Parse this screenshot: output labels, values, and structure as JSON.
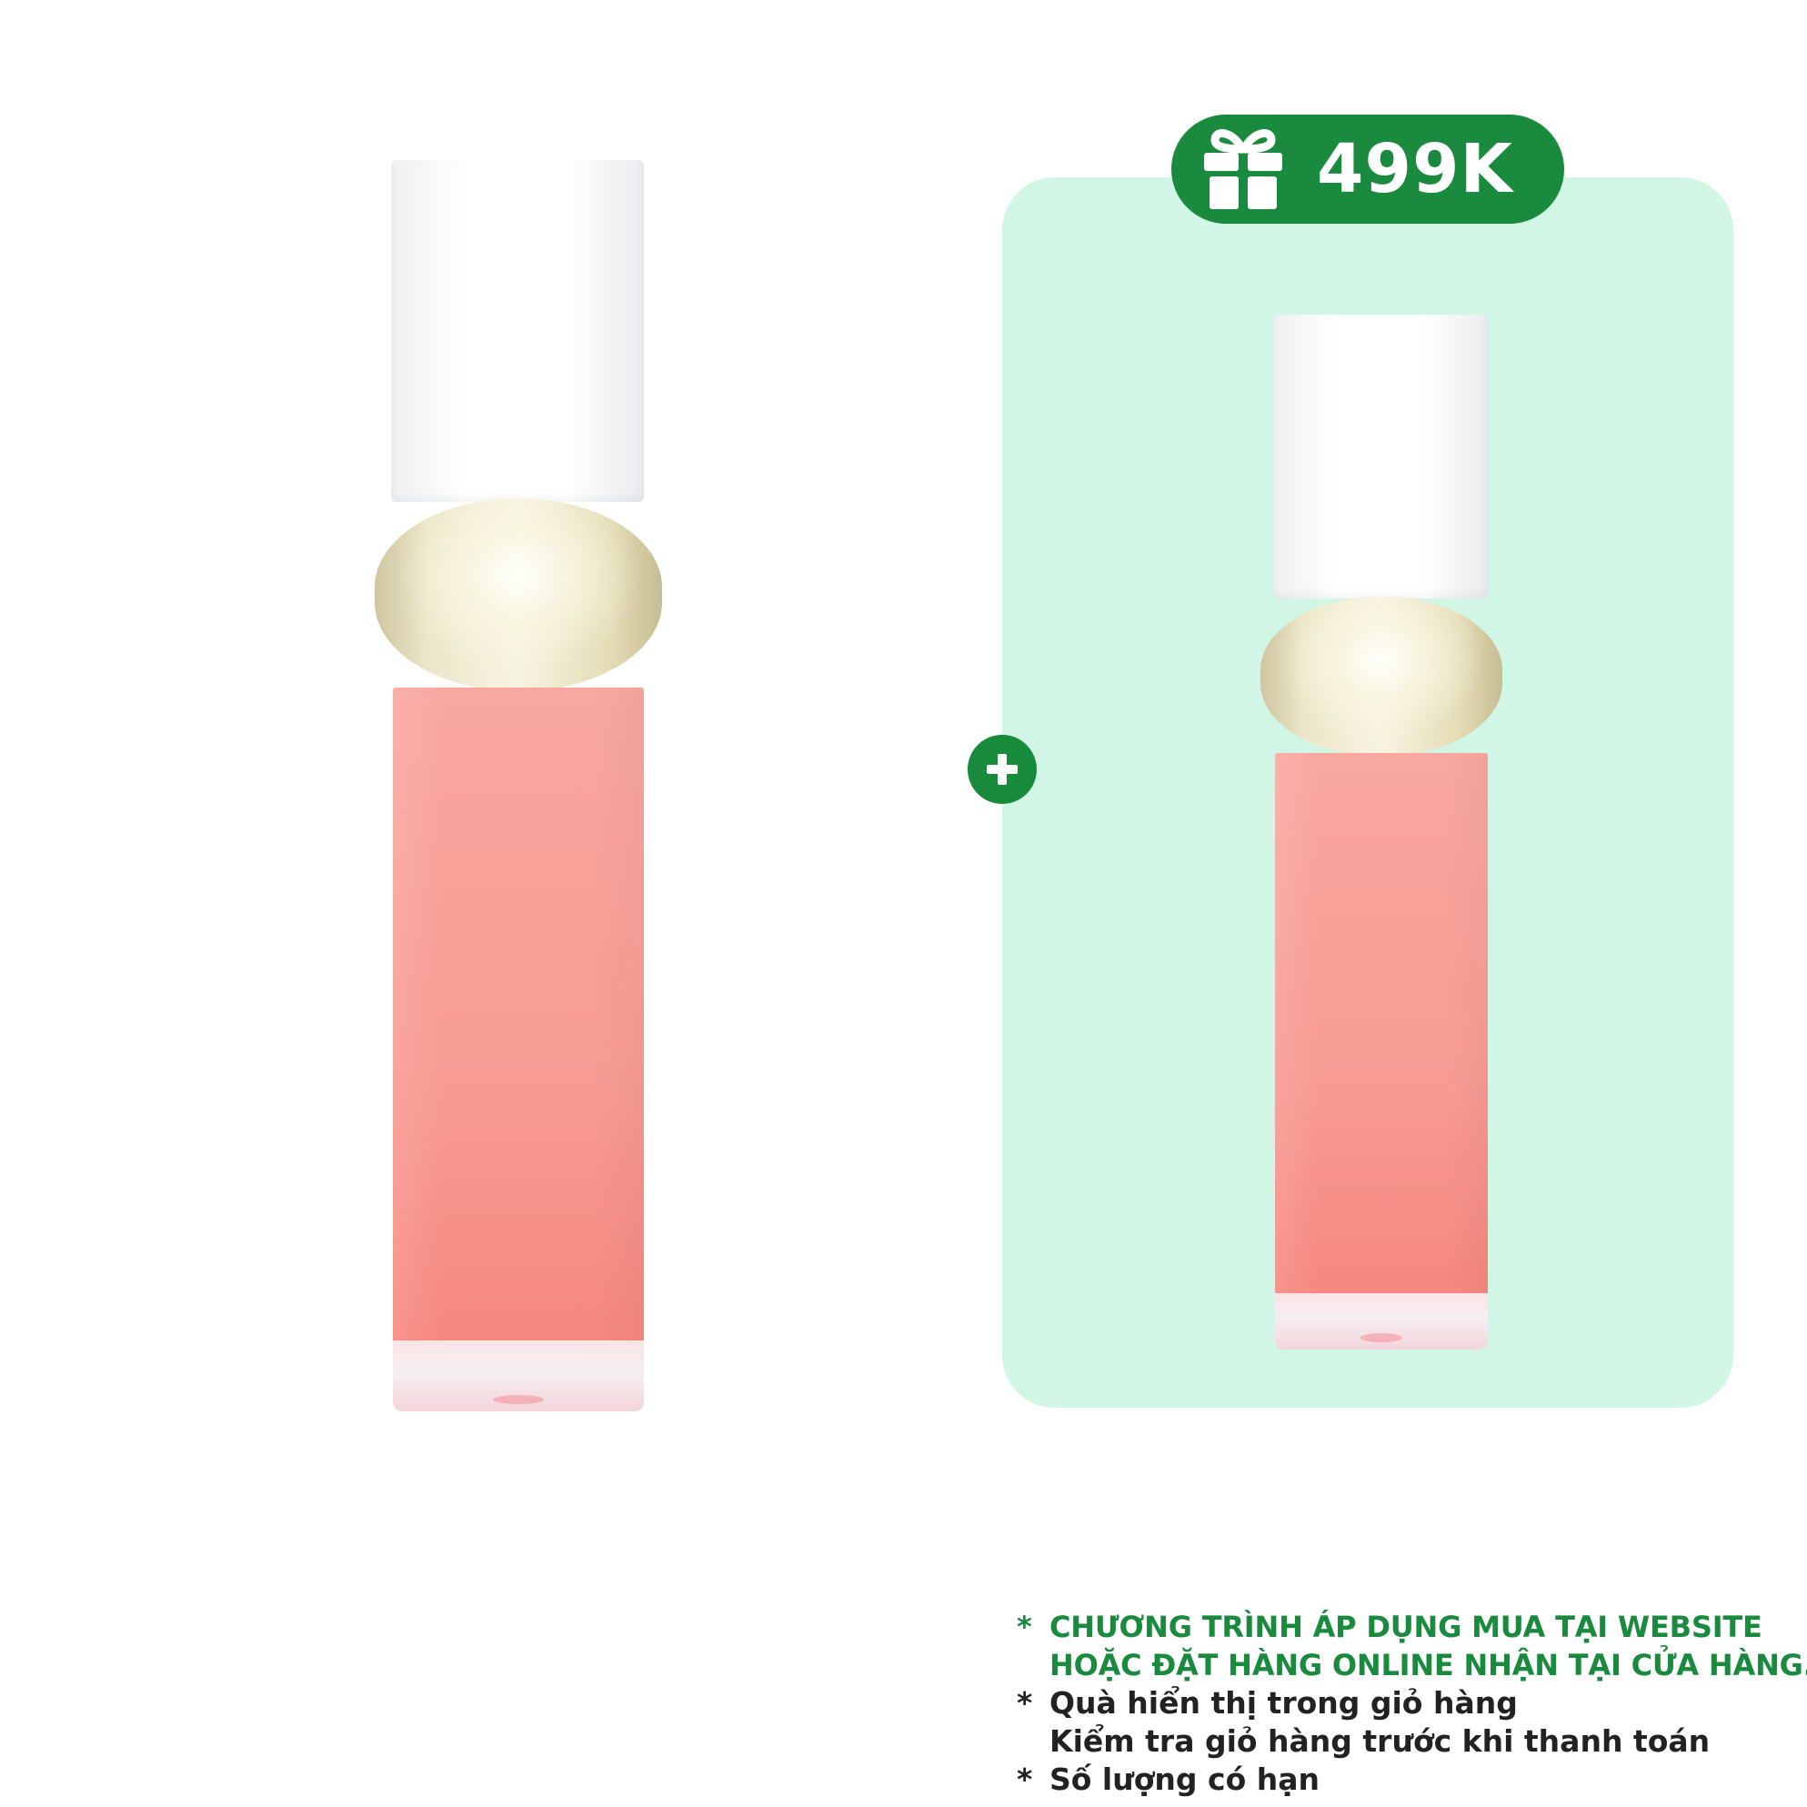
{
  "badge": {
    "icon": "gift-icon",
    "price": "499K",
    "color": "#1a8a3e"
  },
  "panel": {
    "background": "#d1f6e5"
  },
  "plus_button": {
    "icon": "plus-icon"
  },
  "notes": {
    "bullet": "*",
    "program": {
      "line1": "CHƯƠNG TRÌNH ÁP DỤNG MUA TẠI WEBSITE",
      "line2": "HOẶC ĐẶT HÀNG ONLINE NHẬN TẠI CỬA HÀNG."
    },
    "gift": {
      "line1": "Quà hiển thị trong giỏ hàng",
      "line2": "Kiểm tra giỏ hàng trước khi thanh toán"
    },
    "limited": {
      "line1": "Số lượng có hạn"
    }
  }
}
